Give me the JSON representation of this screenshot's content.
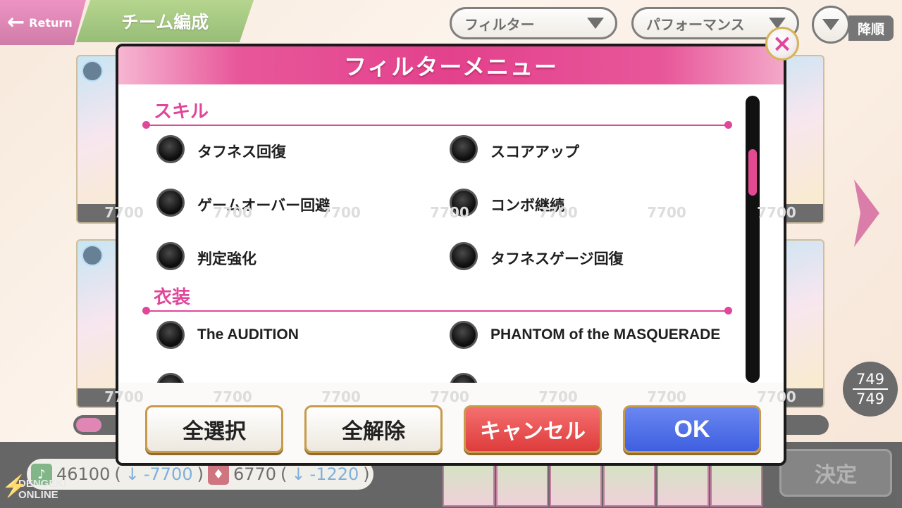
{
  "header": {
    "return_label": "Return",
    "screen_title": "チーム編成",
    "filter_label": "フィルター",
    "sort_key_label": "パフォーマンス",
    "sort_order_label": "降順"
  },
  "cards": {
    "row1_value": "7700",
    "row2_value": "7700"
  },
  "card_counter": {
    "current": "749",
    "total": "749"
  },
  "team_stats": {
    "score": "46100",
    "score_open": "(",
    "score_arrow": "↓",
    "score_delta": "-7700",
    "score_close": ")",
    "toughness": "6770",
    "toughness_open": "(",
    "toughness_arrow": "↓",
    "toughness_delta": "-1220",
    "toughness_close": ")"
  },
  "confirm_label": "決定",
  "watermark": {
    "line1": "DENGEKI",
    "line2": "ONLINE"
  },
  "modal": {
    "title": "フィルターメニュー",
    "sections": [
      {
        "title": "スキル",
        "options": [
          "タフネス回復",
          "スコアアップ",
          "ゲームオーバー回避",
          "コンボ継続",
          "判定強化",
          "タフネスゲージ回復"
        ]
      },
      {
        "title": "衣装",
        "options": [
          "The AUDITION",
          "PHANTOM of the MASQUERADE"
        ]
      }
    ],
    "buttons": {
      "select_all": "全選択",
      "deselect_all": "全解除",
      "cancel": "キャンセル",
      "ok": "OK"
    },
    "close_icon": "×"
  },
  "colors": {
    "accent_pink": "#e0479a",
    "ok_blue": "#4a6be6",
    "cancel_red": "#e84a4a",
    "tab_green": "#6fa63a"
  }
}
